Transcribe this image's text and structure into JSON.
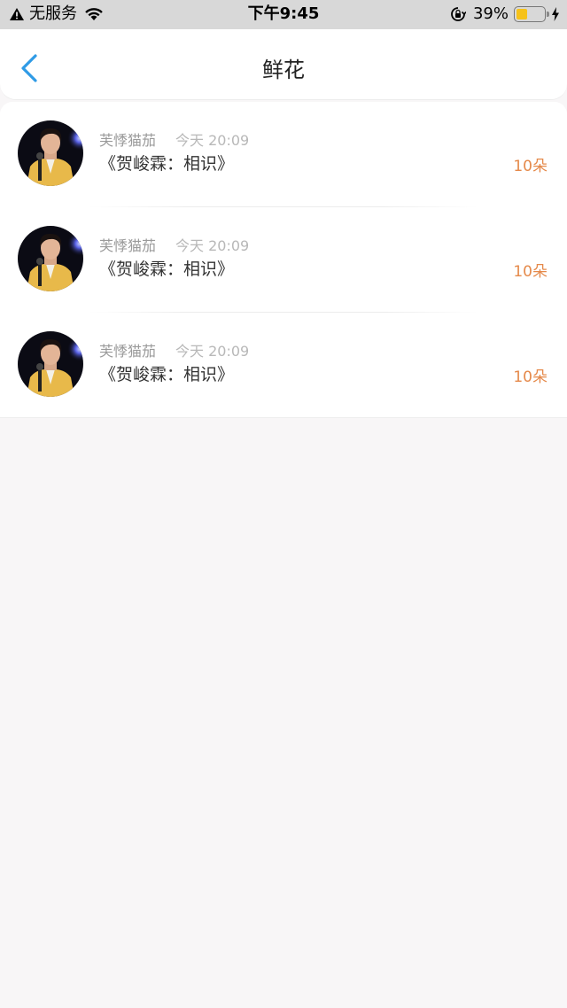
{
  "status_bar": {
    "carrier": "无服务",
    "time": "下午9:45",
    "battery": "39%",
    "battery_level": 0.39
  },
  "nav": {
    "title": "鲜花"
  },
  "items": [
    {
      "user": "芙悸猫茄",
      "time": "今天 20:09",
      "title": "《贺峻霖：相识》",
      "count": "10朵"
    },
    {
      "user": "芙悸猫茄",
      "time": "今天 20:09",
      "title": "《贺峻霖：相识》",
      "count": "10朵"
    },
    {
      "user": "芙悸猫茄",
      "time": "今天 20:09",
      "title": "《贺峻霖：相识》",
      "count": "10朵"
    }
  ],
  "colors": {
    "accent": "#2f9be6",
    "count": "#e5894a",
    "battery": "#f6c21a"
  }
}
